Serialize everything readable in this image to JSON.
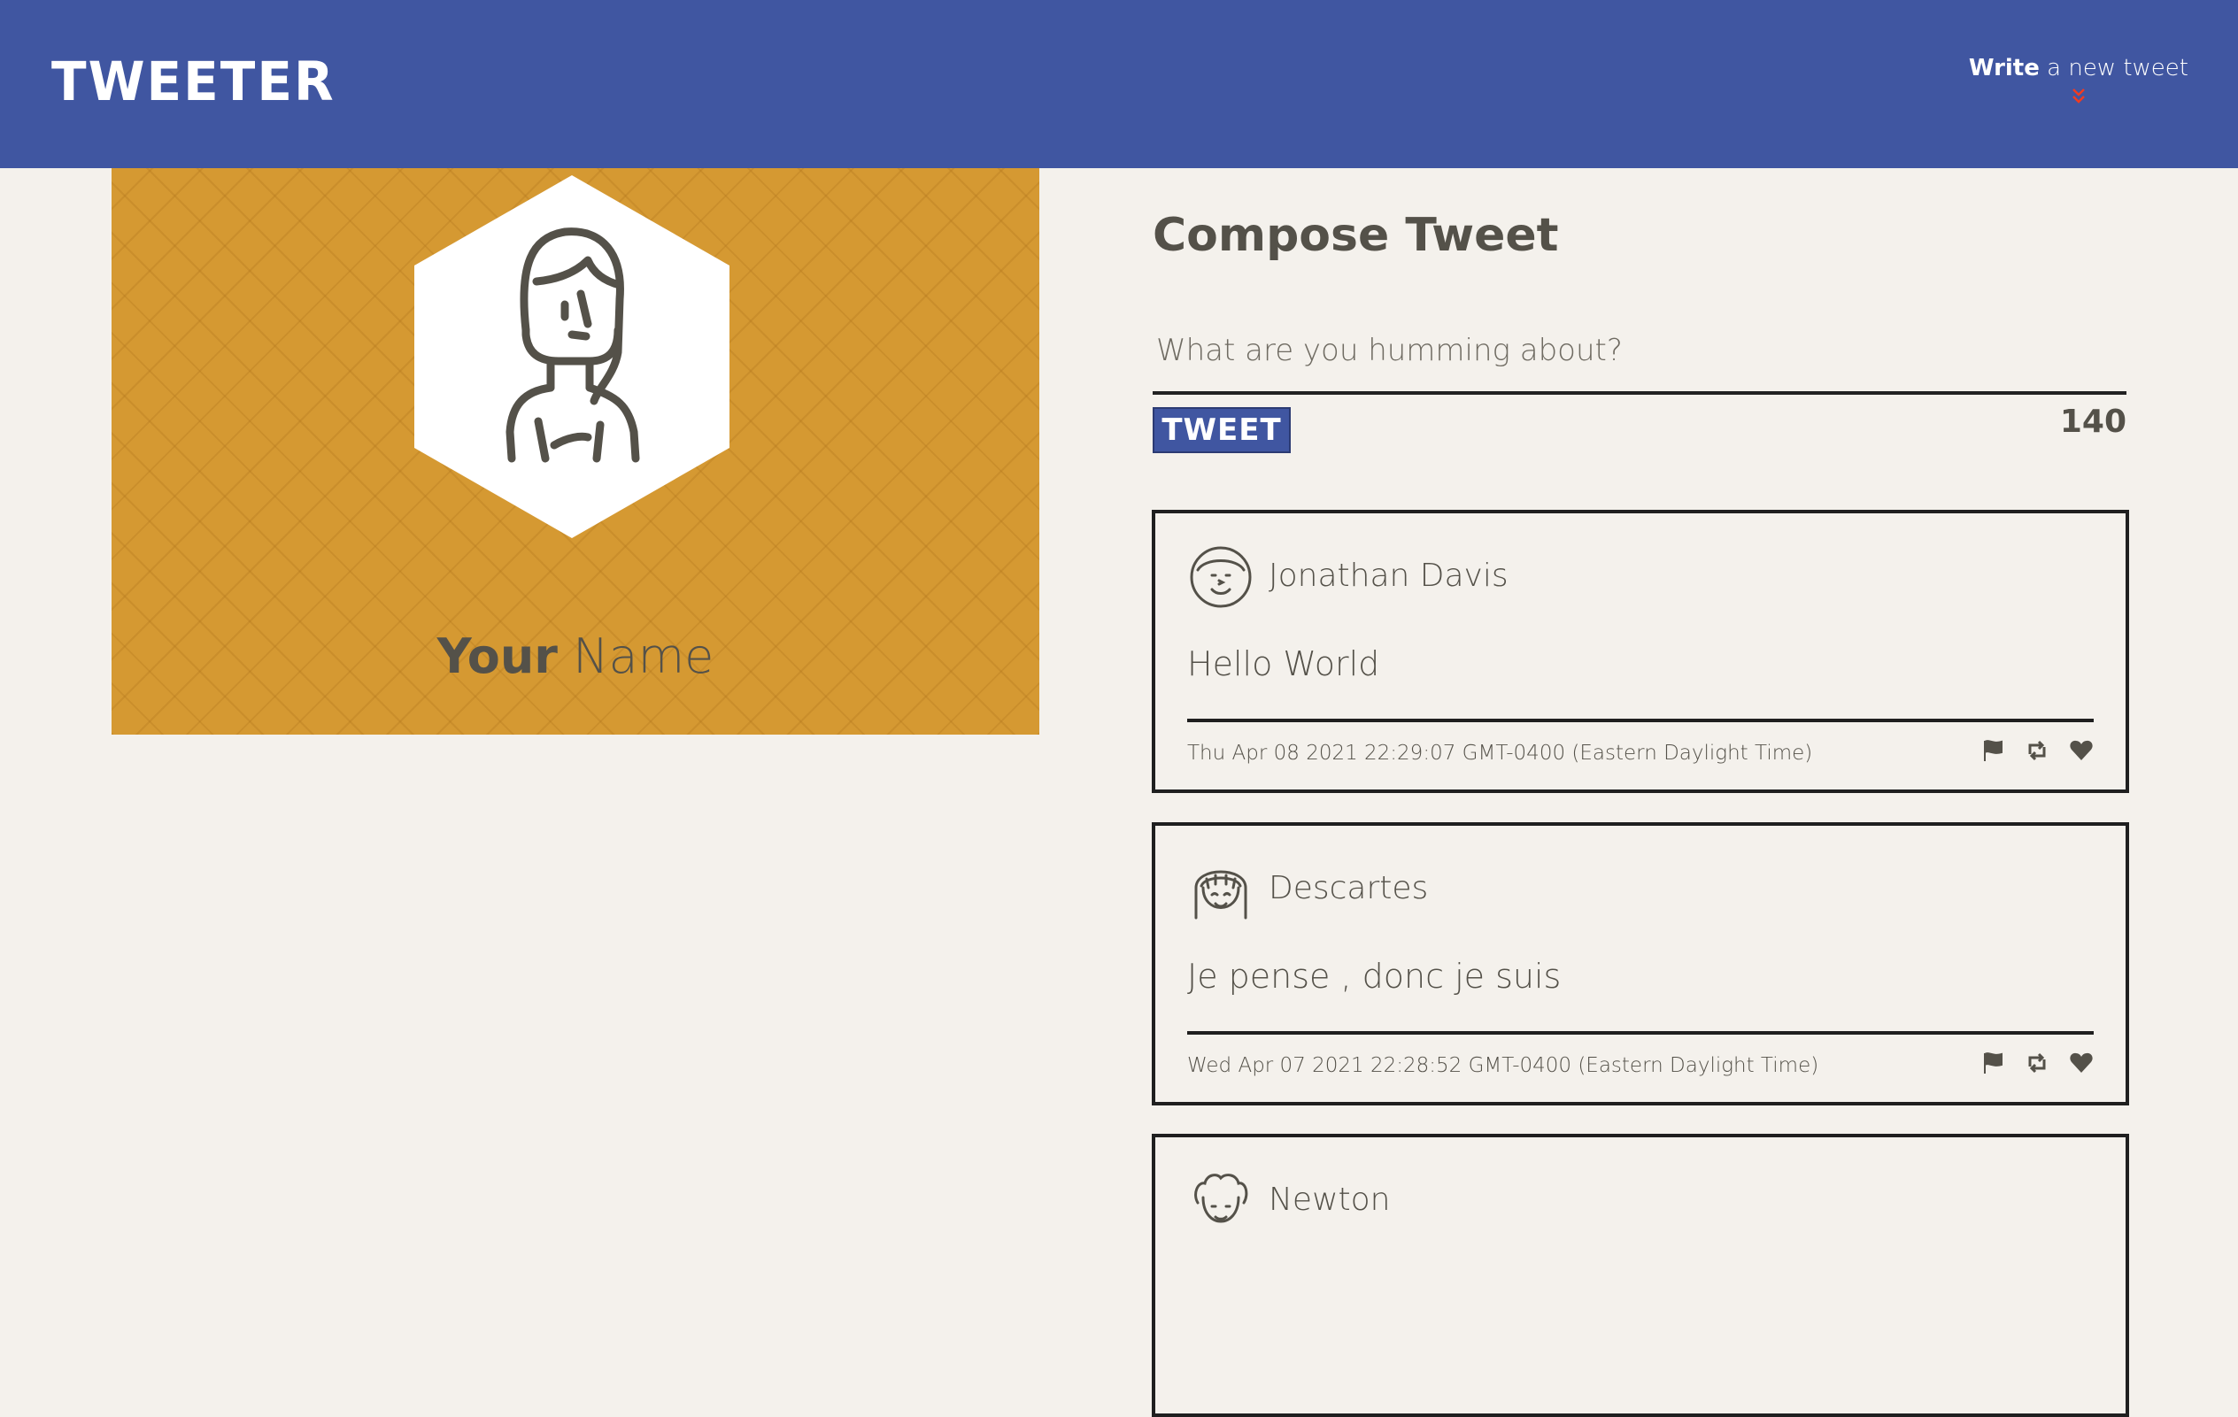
{
  "nav": {
    "brand": "TWEETER",
    "write_bold": "Write",
    "write_rest": " a new tweet",
    "arrow_icon": "double-chevron-down-icon"
  },
  "profile": {
    "name_first": "Your",
    "name_last": " Name",
    "avatar_icon": "girl-avatar-icon",
    "background_color": "#d59932"
  },
  "compose": {
    "title": "Compose Tweet",
    "placeholder": "What are you humming about?",
    "button_label": "TWEET",
    "counter": "140"
  },
  "tweets": [
    {
      "author": "Jonathan Davis",
      "avatar_icon": "smiling-man-avatar-icon",
      "content": "Hello World",
      "date": "Thu Apr 08 2021 22:29:07 GMT-0400 (Eastern Daylight Time)"
    },
    {
      "author": "Descartes",
      "avatar_icon": "girl-bangs-avatar-icon",
      "content": "Je pense , donc je suis",
      "date": "Wed Apr 07 2021 22:28:52 GMT-0400 (Eastern Daylight Time)"
    },
    {
      "author": "Newton",
      "avatar_icon": "curly-hair-avatar-icon",
      "content": "",
      "date": ""
    }
  ],
  "actions": {
    "flag_icon": "flag-icon",
    "retweet_icon": "retweet-icon",
    "like_icon": "heart-icon"
  },
  "colors": {
    "nav": "#4056a1",
    "accent": "#f13c20",
    "background": "#f4f1ec",
    "text": "#545149"
  }
}
